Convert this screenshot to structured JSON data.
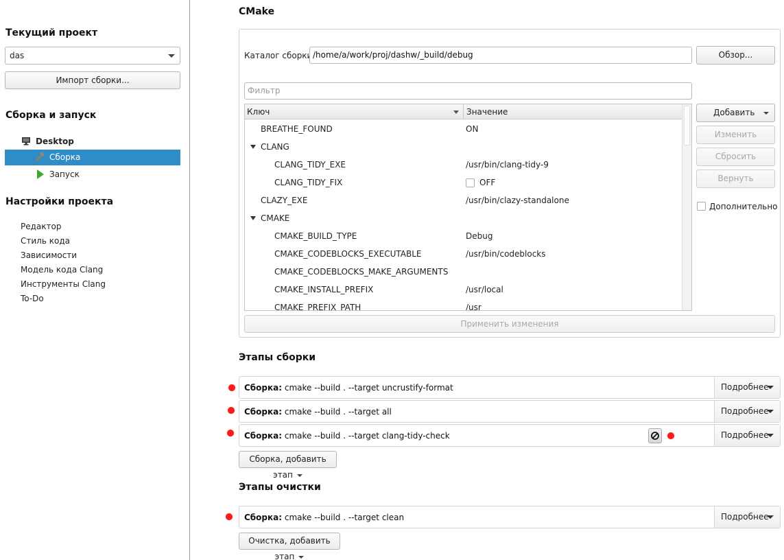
{
  "sidebar": {
    "current_project_heading": "Текущий проект",
    "project_combo_value": "das",
    "import_build_button": "Импорт сборки...",
    "build_run_heading": "Сборка и запуск",
    "desktop_label": "Desktop",
    "build_item": "Сборка",
    "run_item": "Запуск",
    "project_settings_heading": "Настройки проекта",
    "settings_links": [
      "Редактор",
      "Стиль кода",
      "Зависимости",
      "Модель кода Clang",
      "Инструменты Clang",
      "To-Do"
    ]
  },
  "cmake": {
    "title": "CMake",
    "build_dir_label": "Каталог сборки:",
    "build_dir_value": "/home/a/work/proj/dashw/_build/debug",
    "browse_button": "Обзор...",
    "filter_placeholder": "Фильтр",
    "col_key": "Ключ",
    "col_value": "Значение",
    "rows": [
      {
        "key": "BREATHE_FOUND",
        "value": "ON"
      },
      {
        "key": "CLANG",
        "value": ""
      },
      {
        "key": "CLANG_TIDY_EXE",
        "value": "/usr/bin/clang-tidy-9"
      },
      {
        "key": "CLANG_TIDY_FIX",
        "value": "OFF"
      },
      {
        "key": "CLAZY_EXE",
        "value": "/usr/bin/clazy-standalone"
      },
      {
        "key": "CMAKE",
        "value": ""
      },
      {
        "key": "CMAKE_BUILD_TYPE",
        "value": "Debug"
      },
      {
        "key": "CMAKE_CODEBLOCKS_EXECUTABLE",
        "value": "/usr/bin/codeblocks"
      },
      {
        "key": "CMAKE_CODEBLOCKS_MAKE_ARGUMENTS",
        "value": ""
      },
      {
        "key": "CMAKE_INSTALL_PREFIX",
        "value": "/usr/local"
      },
      {
        "key": "CMAKE_PREFIX_PATH",
        "value": "/usr"
      }
    ],
    "add_button": "Добавить",
    "edit_button": "Изменить",
    "reset_button": "Сбросить",
    "revert_button": "Вернуть",
    "advanced_label": "Дополнительно",
    "apply_button": "Применить изменения"
  },
  "build_steps": {
    "title": "Этапы сборки",
    "step_prefix": "Сборка:",
    "steps": [
      "cmake --build . --target uncrustify-format",
      "cmake --build . --target all",
      "cmake --build . --target clang-tidy-check"
    ],
    "details_label": "Подробнее",
    "add_step_button": "Сборка, добавить этап"
  },
  "clean_steps": {
    "title": "Этапы очистки",
    "step_prefix": "Сборка:",
    "steps": [
      "cmake --build . --target clean"
    ],
    "details_label": "Подробнее",
    "add_step_button": "Очистка, добавить этап"
  },
  "colors": {
    "selection": "#308cc6",
    "marker": "#ff1a1a",
    "run_icon": "#3daa2f"
  }
}
